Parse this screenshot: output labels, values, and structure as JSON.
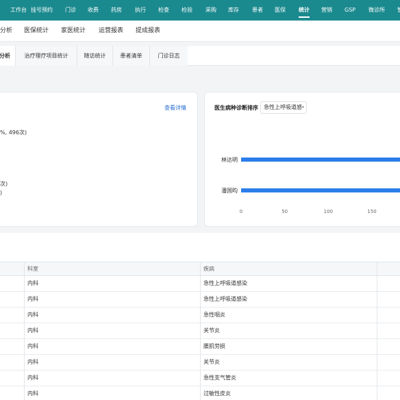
{
  "topnav": {
    "items": [
      {
        "label": "工作台",
        "active": false
      },
      {
        "label": "挂号预约",
        "active": false
      },
      {
        "label": "门诊",
        "active": false
      },
      {
        "label": "收费",
        "active": false
      },
      {
        "label": "药房",
        "active": false
      },
      {
        "label": "执行",
        "active": false
      },
      {
        "label": "检查",
        "active": false
      },
      {
        "label": "检验",
        "active": false
      },
      {
        "label": "采购",
        "active": false
      },
      {
        "label": "库存",
        "active": false
      },
      {
        "label": "患者",
        "active": false
      },
      {
        "label": "医保",
        "active": false
      },
      {
        "label": "统计",
        "active": true
      },
      {
        "label": "营销",
        "active": false
      },
      {
        "label": "GSP",
        "active": false
      },
      {
        "label": "微诊所",
        "active": false
      },
      {
        "label": "管",
        "active": false
      }
    ]
  },
  "subnav": {
    "items": [
      "分析",
      "医保统计",
      "家医统计",
      "运营报表",
      "提成报表"
    ]
  },
  "tabs": {
    "items": [
      "分析",
      "治疗理疗项目统计",
      "随访统计",
      "患者清单",
      "门诊日志"
    ]
  },
  "summary": {
    "view_detail": "查看详情",
    "line1": "%, 496次)",
    "line2": "次)",
    "line3": ")"
  },
  "chart": {
    "title": "医生病种诊断排序",
    "select_value": "急性上呼吸道感",
    "caret": "▾"
  },
  "chart_data": {
    "type": "bar",
    "orientation": "horizontal",
    "categories": [
      "林达明",
      "潘国昀"
    ],
    "values": [
      190,
      190
    ],
    "xticks": [
      "0",
      "50",
      "100",
      "150"
    ],
    "xlim": [
      0,
      190
    ],
    "color": "#2b7de9"
  },
  "table": {
    "headers": [
      "科室",
      "疾病"
    ],
    "rows": [
      [
        "内科",
        "急性上呼吸道感染"
      ],
      [
        "内科",
        "急性上呼吸道感染"
      ],
      [
        "内科",
        "急性咽炎"
      ],
      [
        "内科",
        "关节炎"
      ],
      [
        "内科",
        "腰肌劳损"
      ],
      [
        "内科",
        "关节炎"
      ],
      [
        "内科",
        "急性支气管炎"
      ],
      [
        "内科",
        "过敏性皮炎"
      ]
    ]
  }
}
